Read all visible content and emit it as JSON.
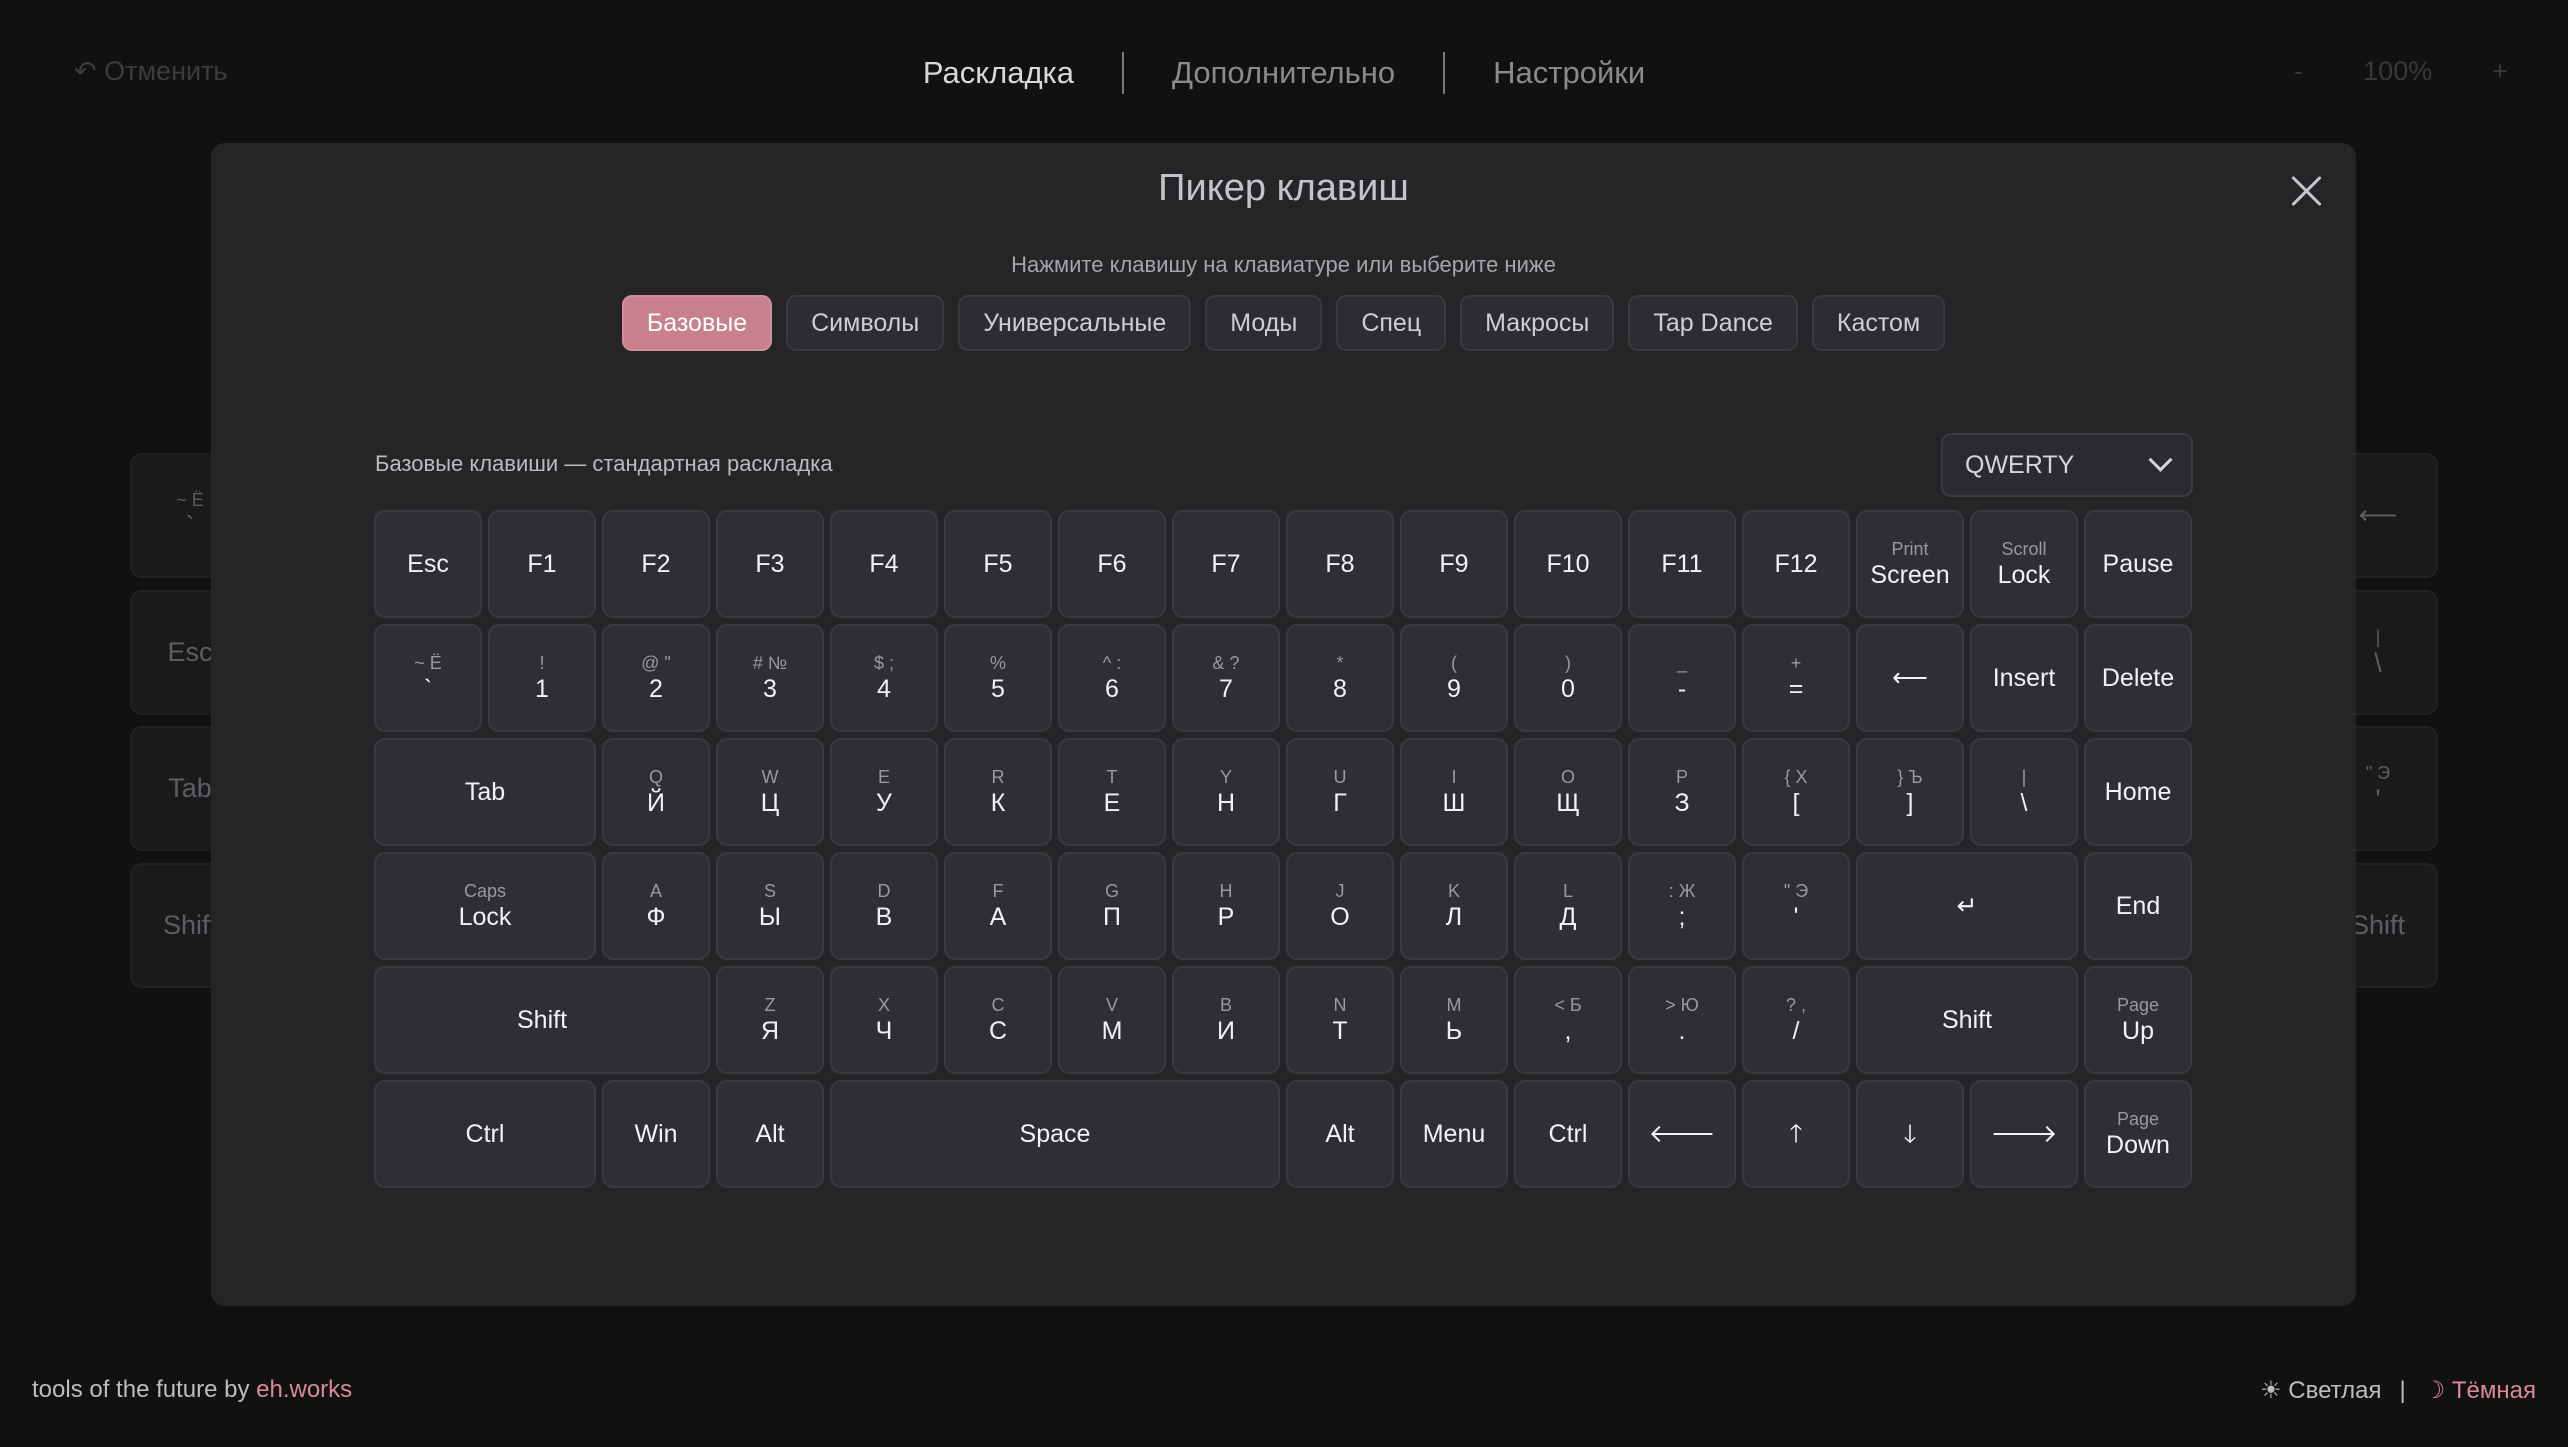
{
  "topbar": {
    "undo_label": "↶ Отменить",
    "tabs": [
      {
        "label": "Раскладка"
      },
      {
        "label": "Дополнительно"
      },
      {
        "label": "Настройки"
      }
    ],
    "zoom_out": "-",
    "zoom_level": "100%",
    "zoom_in": "+"
  },
  "background_keys": {
    "k1_sub": "~ Ё",
    "k1_main": "`",
    "k2": "Esc",
    "k3": "Tab",
    "k4": "Shift",
    "r1": "⟵",
    "r2_sub": "|",
    "r2_main": "\\",
    "r3_sub": "\" Э",
    "r3_main": "'",
    "r4": "Shift"
  },
  "modal": {
    "title": "Пикер клавиш",
    "hint": "Нажмите клавишу на клавиатуре или выберите ниже",
    "categories": [
      {
        "label": "Базовые"
      },
      {
        "label": "Символы"
      },
      {
        "label": "Универсальные"
      },
      {
        "label": "Моды"
      },
      {
        "label": "Спец"
      },
      {
        "label": "Макросы"
      },
      {
        "label": "Tap Dance"
      },
      {
        "label": "Кастом"
      }
    ],
    "section_label": "Базовые клавиши — стандартная раскладка",
    "layout_select": "QWERTY"
  },
  "keyboard": {
    "rows": [
      [
        {
          "main": "Esc",
          "w": 1
        },
        {
          "main": "F1",
          "w": 1
        },
        {
          "main": "F2",
          "w": 1
        },
        {
          "main": "F3",
          "w": 1
        },
        {
          "main": "F4",
          "w": 1
        },
        {
          "main": "F5",
          "w": 1
        },
        {
          "main": "F6",
          "w": 1
        },
        {
          "main": "F7",
          "w": 1
        },
        {
          "main": "F8",
          "w": 1
        },
        {
          "main": "F9",
          "w": 1
        },
        {
          "main": "F10",
          "w": 1
        },
        {
          "main": "F11",
          "w": 1
        },
        {
          "main": "F12",
          "w": 1
        },
        {
          "sub": "Print",
          "main": "Screen",
          "w": 1
        },
        {
          "sub": "Scroll",
          "main": "Lock",
          "w": 1
        },
        {
          "main": "Pause",
          "w": 1
        }
      ],
      [
        {
          "sub": "~ Ё",
          "main": "`",
          "w": 1
        },
        {
          "sub": "!",
          "main": "1",
          "w": 1
        },
        {
          "sub": "@ \"",
          "main": "2",
          "w": 1
        },
        {
          "sub": "# №",
          "main": "3",
          "w": 1
        },
        {
          "sub": "$ ;",
          "main": "4",
          "w": 1
        },
        {
          "sub": "%",
          "main": "5",
          "w": 1
        },
        {
          "sub": "^ :",
          "main": "6",
          "w": 1
        },
        {
          "sub": "& ?",
          "main": "7",
          "w": 1
        },
        {
          "sub": "*",
          "main": "8",
          "w": 1
        },
        {
          "sub": "(",
          "main": "9",
          "w": 1
        },
        {
          "sub": ")",
          "main": "0",
          "w": 1
        },
        {
          "sub": "_",
          "main": "-",
          "w": 1
        },
        {
          "sub": "+",
          "main": "=",
          "w": 1
        },
        {
          "main": "⟵",
          "w": 1
        },
        {
          "main": "Insert",
          "w": 1
        },
        {
          "main": "Delete",
          "w": 1
        }
      ],
      [
        {
          "main": "Tab",
          "w": 2
        },
        {
          "sub": "Q",
          "main": "Й",
          "w": 1
        },
        {
          "sub": "W",
          "main": "Ц",
          "w": 1
        },
        {
          "sub": "E",
          "main": "У",
          "w": 1
        },
        {
          "sub": "R",
          "main": "К",
          "w": 1
        },
        {
          "sub": "T",
          "main": "Е",
          "w": 1
        },
        {
          "sub": "Y",
          "main": "Н",
          "w": 1
        },
        {
          "sub": "U",
          "main": "Г",
          "w": 1
        },
        {
          "sub": "I",
          "main": "Ш",
          "w": 1
        },
        {
          "sub": "O",
          "main": "Щ",
          "w": 1
        },
        {
          "sub": "P",
          "main": "З",
          "w": 1
        },
        {
          "sub": "{ Х",
          "main": "[",
          "w": 1
        },
        {
          "sub": "} Ъ",
          "main": "]",
          "w": 1
        },
        {
          "sub": "|",
          "main": "\\",
          "w": 1
        },
        {
          "main": "Home",
          "w": 1
        }
      ],
      [
        {
          "sub": "Caps",
          "main": "Lock",
          "w": 2
        },
        {
          "sub": "A",
          "main": "Ф",
          "w": 1
        },
        {
          "sub": "S",
          "main": "Ы",
          "w": 1
        },
        {
          "sub": "D",
          "main": "В",
          "w": 1
        },
        {
          "sub": "F",
          "main": "А",
          "w": 1
        },
        {
          "sub": "G",
          "main": "П",
          "w": 1
        },
        {
          "sub": "H",
          "main": "Р",
          "w": 1
        },
        {
          "sub": "J",
          "main": "О",
          "w": 1
        },
        {
          "sub": "K",
          "main": "Л",
          "w": 1
        },
        {
          "sub": "L",
          "main": "Д",
          "w": 1
        },
        {
          "sub": ": Ж",
          "main": ";",
          "w": 1
        },
        {
          "sub": "\" Э",
          "main": "'",
          "w": 1
        },
        {
          "main": "↵",
          "w": 2
        },
        {
          "main": "End",
          "w": 1
        }
      ],
      [
        {
          "main": "Shift",
          "w": 3
        },
        {
          "sub": "Z",
          "main": "Я",
          "w": 1
        },
        {
          "sub": "X",
          "main": "Ч",
          "w": 1
        },
        {
          "sub": "C",
          "main": "С",
          "w": 1
        },
        {
          "sub": "V",
          "main": "М",
          "w": 1
        },
        {
          "sub": "B",
          "main": "И",
          "w": 1
        },
        {
          "sub": "N",
          "main": "Т",
          "w": 1
        },
        {
          "sub": "M",
          "main": "Ь",
          "w": 1
        },
        {
          "sub": "< Б",
          "main": ",",
          "w": 1
        },
        {
          "sub": "> Ю",
          "main": ".",
          "w": 1
        },
        {
          "sub": "? ,",
          "main": "/",
          "w": 1
        },
        {
          "main": "Shift",
          "w": 2
        },
        {
          "sub": "Page",
          "main": "Up",
          "w": 1
        }
      ],
      [
        {
          "main": "Ctrl",
          "w": 2
        },
        {
          "main": "Win",
          "w": 1
        },
        {
          "main": "Alt",
          "w": 1
        },
        {
          "main": "Space",
          "w": 4
        },
        {
          "main": "Alt",
          "w": 1
        },
        {
          "main": "Menu",
          "w": 1
        },
        {
          "main": "Ctrl",
          "w": 1
        },
        {
          "main": "🡐",
          "w": 1
        },
        {
          "main": "🡑",
          "w": 1
        },
        {
          "main": "🡓",
          "w": 1
        },
        {
          "main": "🡒",
          "w": 1
        },
        {
          "sub": "Page",
          "main": "Down",
          "w": 1
        }
      ]
    ]
  },
  "footer": {
    "prefix": "tools of the future by ",
    "brand": "eh.works",
    "light_theme": "☀ Светлая",
    "separator": "|",
    "dark_theme": "☽ Тёмная"
  },
  "colors": {
    "accent": "#c6808e",
    "background": "#111112",
    "modal": "#252528",
    "key": "#2f2f33"
  }
}
